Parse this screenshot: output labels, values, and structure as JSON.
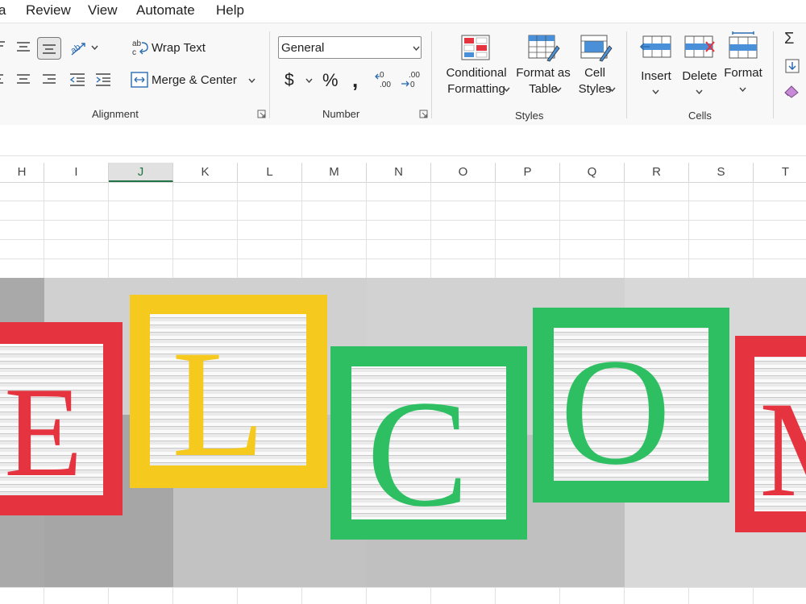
{
  "menubar": {
    "items": [
      "a",
      "Review",
      "View",
      "Automate",
      "Help"
    ]
  },
  "ribbon": {
    "alignment": {
      "group_label": "Alignment",
      "wrap_text_label": "Wrap Text",
      "merge_center_label": "Merge & Center"
    },
    "number": {
      "group_label": "Number",
      "format_value": "General"
    },
    "styles": {
      "group_label": "Styles",
      "conditional_formatting_label": [
        "Conditional",
        "Formatting"
      ],
      "format_as_table_label": [
        "Format as",
        "Table"
      ],
      "cell_styles_label": [
        "Cell",
        "Styles"
      ]
    },
    "cells": {
      "group_label": "Cells",
      "insert_label": "Insert",
      "delete_label": "Delete",
      "format_label": "Format"
    }
  },
  "columns": [
    "H",
    "I",
    "J",
    "K",
    "L",
    "M",
    "N",
    "O",
    "P",
    "Q",
    "R",
    "S",
    "T"
  ],
  "selected_column": "J",
  "image": {
    "description_letters": [
      "E",
      "L",
      "C",
      "O",
      "M"
    ]
  },
  "colors": {
    "excel_green": "#217346",
    "block_red": "#e53340",
    "block_yellow": "#f6c91e",
    "block_green": "#2fbf63"
  }
}
